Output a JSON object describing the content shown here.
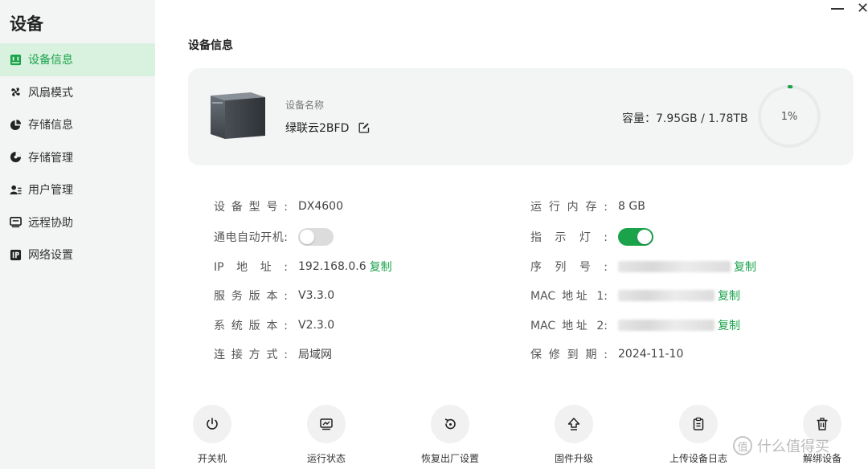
{
  "sidebar": {
    "title": "设备",
    "items": [
      {
        "label": "设备信息",
        "icon": "device-info-icon",
        "active": true
      },
      {
        "label": "风扇模式",
        "icon": "fan-icon",
        "active": false
      },
      {
        "label": "存储信息",
        "icon": "pie-chart-icon",
        "active": false
      },
      {
        "label": "存储管理",
        "icon": "storage-manage-icon",
        "active": false
      },
      {
        "label": "用户管理",
        "icon": "users-icon",
        "active": false
      },
      {
        "label": "远程协助",
        "icon": "monitor-icon",
        "active": false
      },
      {
        "label": "网络设置",
        "icon": "ip-icon",
        "active": false
      }
    ]
  },
  "window": {
    "close_glyph": "✕"
  },
  "page_title": "设备信息",
  "card": {
    "name_label": "设备名称",
    "name": "绿联云2BFD",
    "capacity": "容量：7.95GB / 1.78TB",
    "usage_percent_text": "1%",
    "usage_fraction": 0.01
  },
  "info_left": [
    {
      "label": "设备型号:",
      "value": "DX4600"
    },
    {
      "label": "通电自动开机:",
      "toggle": false
    },
    {
      "label": "IP地址:",
      "value": "192.168.0.6",
      "copy": "复制"
    },
    {
      "label": "服务版本:",
      "value": "V3.3.0"
    },
    {
      "label": "系统版本:",
      "value": "V2.3.0"
    },
    {
      "label": "连接方式:",
      "value": "局域网"
    }
  ],
  "info_right": [
    {
      "label": "运行内存:",
      "value": "8 GB"
    },
    {
      "label": "指示灯:",
      "toggle": true
    },
    {
      "label": "序列号:",
      "copy": "复制"
    },
    {
      "label": "MAC 地址 1:",
      "copy": "复制"
    },
    {
      "label": "MAC 地址 2:",
      "copy": "复制"
    },
    {
      "label": "保修到期:",
      "value": "2024-11-10"
    }
  ],
  "actions": [
    {
      "label": "开关机",
      "icon": "power-icon"
    },
    {
      "label": "运行状态",
      "icon": "status-monitor-icon"
    },
    {
      "label": "恢复出厂设置",
      "icon": "factory-reset-icon"
    },
    {
      "label": "固件升级",
      "icon": "upgrade-icon"
    },
    {
      "label": "上传设备日志",
      "icon": "clipboard-log-icon"
    },
    {
      "label": "解绑设备",
      "icon": "trash-icon"
    }
  ],
  "watermark": {
    "badge": "值",
    "text": "什么值得买"
  },
  "colors": {
    "accent": "#1aa34a",
    "active_bg": "#d9f1df",
    "sidebar_bg": "#f3f5f4"
  }
}
